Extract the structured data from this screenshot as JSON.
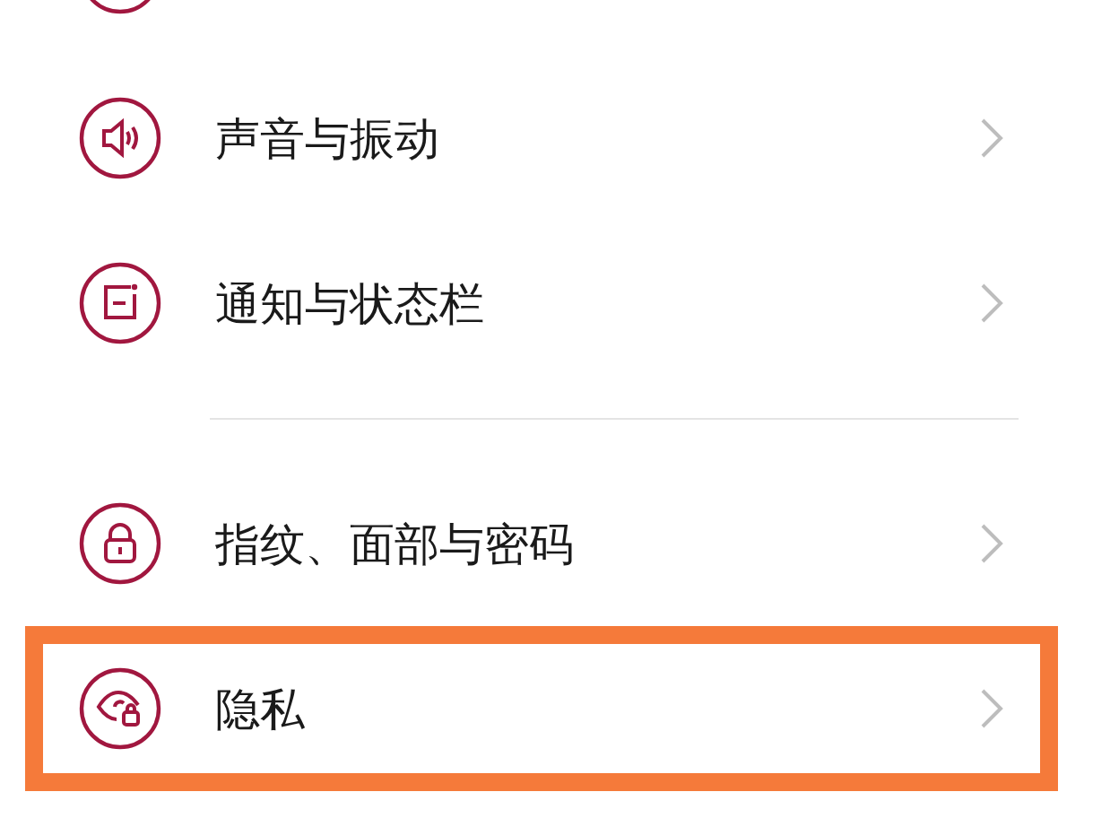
{
  "groups": [
    {
      "items": [
        {
          "kind": "cut"
        },
        {
          "kind": "sound",
          "label": "声音与振动",
          "highlighted": false
        },
        {
          "kind": "notification",
          "label": "通知与状态栏",
          "highlighted": false
        }
      ]
    },
    {
      "items": [
        {
          "kind": "lock",
          "label": "指纹、面部与密码",
          "highlighted": false
        },
        {
          "kind": "privacy",
          "label": "隐私",
          "highlighted": true
        }
      ]
    }
  ]
}
